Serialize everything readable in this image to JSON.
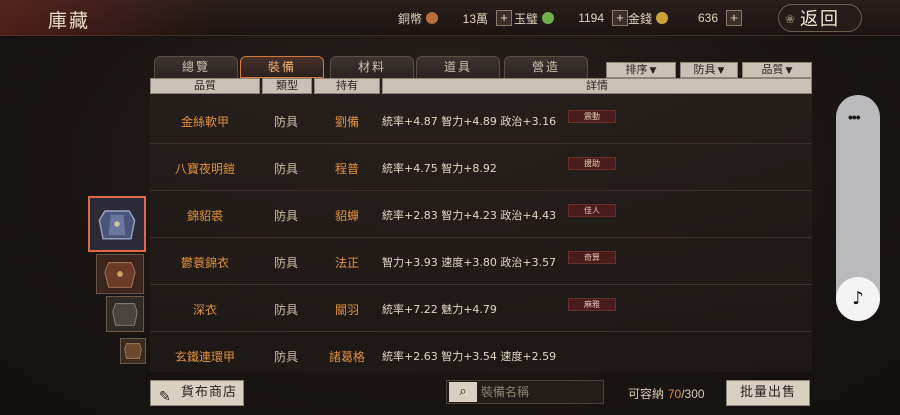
{
  "header": {
    "title": "庫藏",
    "back_label": "返回",
    "currencies": [
      {
        "label": "銅幣",
        "value": "13萬",
        "color": "#b86d3d"
      },
      {
        "label": "玉璧",
        "value": "1194",
        "color": "#6fb04a"
      },
      {
        "label": "金錢",
        "value": "636",
        "color": "#c9a23a"
      }
    ],
    "plus": "+"
  },
  "tabs": [
    {
      "label": "總覽",
      "active": false
    },
    {
      "label": "裝備",
      "active": true
    },
    {
      "label": "材料",
      "active": false
    },
    {
      "label": "道具",
      "active": false
    },
    {
      "label": "營造",
      "active": false
    }
  ],
  "filters": [
    {
      "label": "排序"
    },
    {
      "label": "防具"
    },
    {
      "label": "品質"
    }
  ],
  "columns": [
    "品質",
    "類型",
    "持有",
    "詳情"
  ],
  "rows": [
    {
      "name": "金絲軟甲",
      "type": "防具",
      "owner": "劉備",
      "stats": "統率+4.87  智力+4.89  政治+3.16",
      "tag": "震動"
    },
    {
      "name": "八寶夜明鎧",
      "type": "防具",
      "owner": "程普",
      "stats": "統率+4.75  智力+8.92",
      "tag": "援助"
    },
    {
      "name": "錦貂裘",
      "type": "防具",
      "owner": "貂蟬",
      "stats": "統率+2.83  智力+4.23  政治+4.43",
      "tag": "佳人"
    },
    {
      "name": "鬱蓑錦衣",
      "type": "防具",
      "owner": "法正",
      "stats": "智力+3.93  速度+3.80  政治+3.57",
      "tag": "奇算"
    },
    {
      "name": "深衣",
      "type": "防具",
      "owner": "關羽",
      "stats": "統率+7.22  魅力+4.79",
      "tag": "麻雅"
    },
    {
      "name": "玄鐵連環甲",
      "type": "防具",
      "owner": "諸葛格",
      "stats": "統率+2.63  智力+3.54  速度+2.59",
      "tag": ""
    }
  ],
  "footer": {
    "shop_label": "貨布商店",
    "search_placeholder": "裝備名稱",
    "capacity_label": "可容納",
    "capacity_used": "70",
    "capacity_total": "/300",
    "sell_label": "批量出售"
  },
  "float": {
    "menu": "•••",
    "music": "♪"
  },
  "colors": {
    "accent": "#e0913c",
    "selected_border": "#e06a48"
  }
}
